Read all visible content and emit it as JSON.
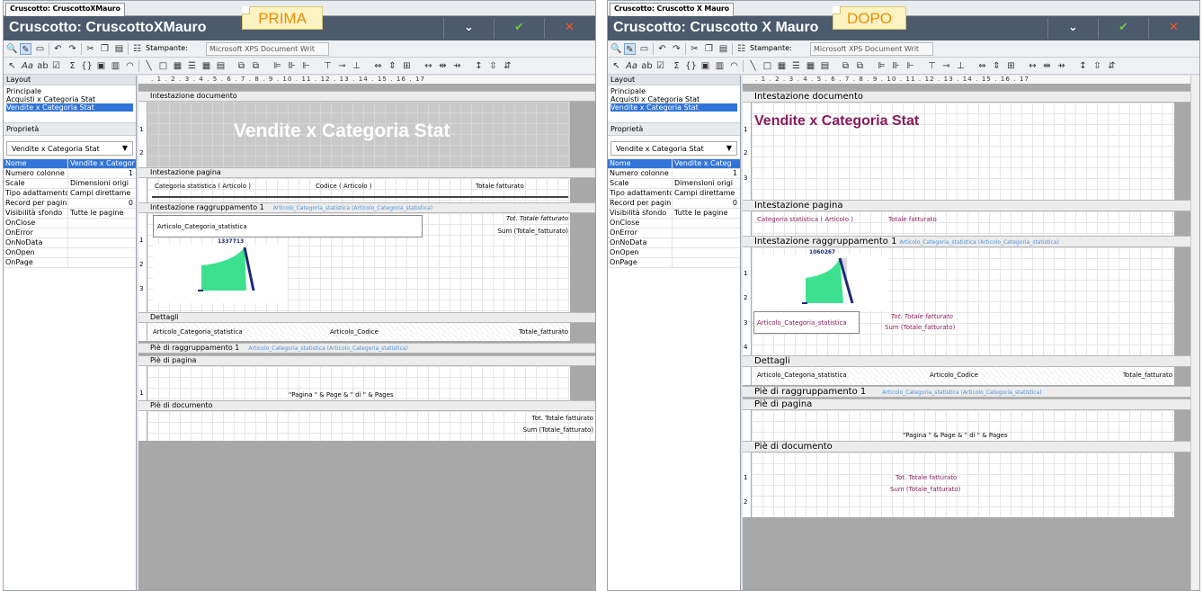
{
  "colors": {
    "titlebar": "#4b5a6c",
    "note_text": "#f08c00",
    "note_bg": "#fdf3c2",
    "selection": "#3275d8",
    "gauge_fill": "#3de08e",
    "gauge_needle": "#1c2a78",
    "magenta_text": "#8b1a5a",
    "group_link": "#4f93d9"
  },
  "left_panel": {
    "tab": "Cruscotto: CruscottoXMauro",
    "note": "PRIMA",
    "title": "Cruscotto: CruscottoXMauro",
    "buttons": {
      "minimize": "⌄",
      "confirm": "✔",
      "close": "✕"
    },
    "printer_label": "Stampante:",
    "printer_value": "Microsoft XPS Document Writ",
    "layout_header": "Layout",
    "layout_items": [
      "Principale",
      "Acquisti x Categoria Stat",
      "Vendite x Categoria Stat"
    ],
    "properties_header": "Proprietà",
    "properties_combo": "Vendite x Categoria Stat",
    "properties": [
      {
        "k": "Nome",
        "v": "Vendite x Categor"
      },
      {
        "k": "Numero colonne",
        "v": "1"
      },
      {
        "k": "Scale",
        "v": "Dimensioni origi"
      },
      {
        "k": "Tipo adattamento c",
        "v": "Campi direttame"
      },
      {
        "k": "Record per pagina",
        "v": "0"
      },
      {
        "k": "Visibilità sfondo",
        "v": "Tutte le pagine"
      },
      {
        "k": "OnClose",
        "v": ""
      },
      {
        "k": "OnError",
        "v": ""
      },
      {
        "k": "OnNoData",
        "v": ""
      },
      {
        "k": "OnOpen",
        "v": ""
      },
      {
        "k": "OnPage",
        "v": ""
      }
    ],
    "ruler": ". 1 . 2 . 3 . 4 . 5 . 6 . 7 . 8 . 9 . 10 . 11 . 12 . 13 . 14 . 15 . 16 . 17",
    "sections": {
      "doc_header": "Intestazione documento",
      "page_header": "Intestazione pagina",
      "group_header": "Intestazione raggruppamento 1",
      "group_ref": "Articolo_Categoria_statistica (Articolo_Categoria_statistica)",
      "details": "Dettagli",
      "group_footer": "Piè di raggruppamento 1",
      "group_footer_ref": "Articolo_Categoria_statistica (Articolo_Categoria_statistica)",
      "page_footer": "Piè di pagina",
      "doc_footer": "Piè di documento"
    },
    "report_title": "Vendite x Categoria Stat",
    "page_cols": [
      "Categoria statistica ( Articolo )",
      "Codice ( Articolo )",
      "Totale fatturato"
    ],
    "group_field": "Articolo_Categoria_statistica",
    "tot_label": "Tot. Totale fatturato",
    "sum_label": "Sum (Totale_fatturato)",
    "gauge_value": "1337713",
    "detail_fields": [
      "Articolo_Categoria_statistica",
      "Articolo_Codice",
      "Totale_fatturato"
    ],
    "page_expr": "\"Pagina \" & Page & \" di \" & Pages",
    "doc_tot": "Tot. Totale fatturato",
    "doc_sum": "Sum (Totale_fatturato)"
  },
  "right_panel": {
    "tab": "Cruscotto: Cruscotto X Mauro",
    "note": "DOPO",
    "title": "Cruscotto: Cruscotto X Mauro",
    "buttons": {
      "minimize": "⌄",
      "confirm": "✔",
      "close": "✕"
    },
    "printer_label": "Stampante:",
    "printer_value": "Microsoft XPS Document Writ",
    "layout_header": "Layout",
    "layout_items": [
      "Principale",
      "Acquisti x Categoria Stat",
      "Vendite x Categoria Stat"
    ],
    "properties_header": "Proprietà",
    "properties_combo": "Vendite x Categoria Stat",
    "properties": [
      {
        "k": "Nome",
        "v": "Vendite x Categ"
      },
      {
        "k": "Numero colonne",
        "v": "1"
      },
      {
        "k": "Scale",
        "v": "Dimensioni origi"
      },
      {
        "k": "Tipo adattamento c",
        "v": "Campi direttame"
      },
      {
        "k": "Record per pagina",
        "v": "0"
      },
      {
        "k": "Visibilità sfondo",
        "v": "Tutte le pagine"
      },
      {
        "k": "OnClose",
        "v": ""
      },
      {
        "k": "OnError",
        "v": ""
      },
      {
        "k": "OnNoData",
        "v": ""
      },
      {
        "k": "OnOpen",
        "v": ""
      },
      {
        "k": "OnPage",
        "v": ""
      }
    ],
    "ruler": ". 1 . 2 . 3 . 4 . 5 . 6 . 7 . 8 . 9 . 10 . 11 . 12 . 13 . 14 . 15 . 16 . 17",
    "sections": {
      "doc_header": "Intestazione documento",
      "page_header": "Intestazione pagina",
      "group_header": "Intestazione raggruppamento 1",
      "group_ref": "Articolo_Categoria_statistica (Articolo_Categoria_statistica)",
      "details": "Dettagli",
      "group_footer": "Piè di raggruppamento 1",
      "group_footer_ref": "Articolo_Categoria_statistica (Articolo_Categoria_statistica)",
      "page_footer": "Piè di pagina",
      "doc_footer": "Piè di documento"
    },
    "report_title": "Vendite x Categoria Stat",
    "page_cols": [
      "Categoria statistica ( Articolo )",
      "Totale fatturato"
    ],
    "group_field": "Articolo_Categoria_statistica",
    "tot_label": "Tot. Totale fatturato",
    "sum_label": "Sum (Totale_fatturato)",
    "gauge_value": "1060267",
    "detail_fields": [
      "Articolo_Categoria_statistica",
      "Articolo_Codice",
      "Totale_fatturato"
    ],
    "page_expr": "\"Pagina \" & Page & \" di \" & Pages",
    "doc_tot": "Tot. Totale fatturato",
    "doc_sum": "Sum (Totale_fatturato)"
  }
}
